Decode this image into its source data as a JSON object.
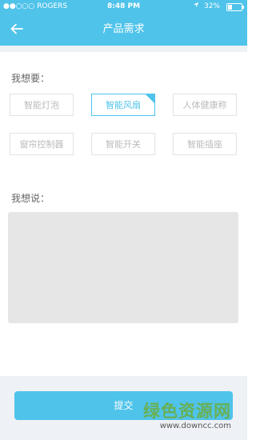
{
  "status_bar": {
    "carrier": "●●○○○ ROGERS",
    "wifi_icon": "wifi-icon",
    "time": "8:48 PM",
    "location_icon": "location-arrow-icon",
    "battery_percent": "32%",
    "battery_level": 0.32
  },
  "header": {
    "title": "产品需求",
    "back_icon": "arrow-left-icon",
    "accent_color": "#4fc3ea"
  },
  "want_section": {
    "label": "我想要：",
    "tags": [
      {
        "label": "智能灯泡",
        "selected": false
      },
      {
        "label": "智能风扇",
        "selected": true
      },
      {
        "label": "人体健康称",
        "selected": false
      },
      {
        "label": "窗帘控制器",
        "selected": false
      },
      {
        "label": "智能开关",
        "selected": false
      },
      {
        "label": "智能插座",
        "selected": false
      }
    ]
  },
  "say_section": {
    "label": "我想说：",
    "textarea_value": ""
  },
  "footer": {
    "submit_label": "提交"
  },
  "watermark": {
    "text": "绿色资源网",
    "url": "www.downcc.com"
  }
}
